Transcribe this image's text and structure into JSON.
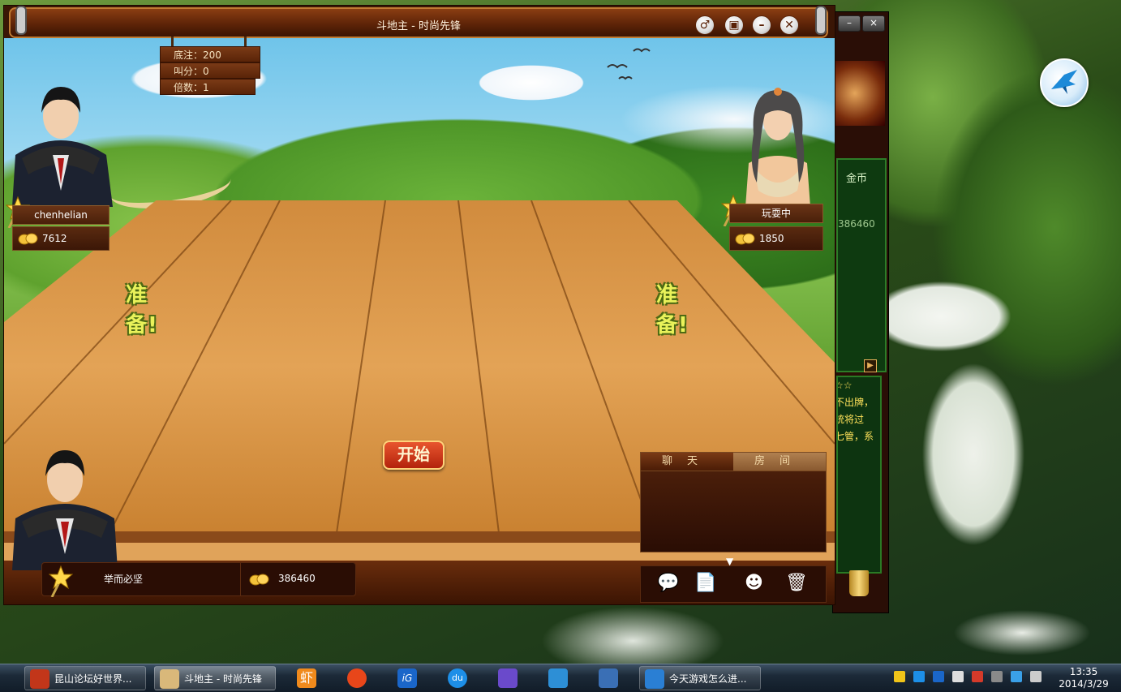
{
  "window": {
    "title": "斗地主 - 时尚先锋"
  },
  "scoreboard": {
    "base_bet": "底注：200",
    "bid": "叫分：0",
    "multiplier": "倍数：1"
  },
  "players": {
    "left": {
      "name": "chenhelian",
      "coins": "7612",
      "status": "准备!"
    },
    "right": {
      "name": "玩耍中",
      "coins": "1850",
      "status": "准备!"
    },
    "self": {
      "name": "举而必坚",
      "coins": "386460"
    }
  },
  "actions": {
    "start": "开始"
  },
  "chat": {
    "tab_chat": "聊天",
    "tab_room": "房间"
  },
  "side_panel": {
    "coin_header": "金币",
    "coin_value": "386460",
    "notice_lines": [
      "☆☆",
      "不出牌，",
      "统将过",
      "七管，系"
    ]
  },
  "taskbar": {
    "items": [
      {
        "label": "昆山论坛好世界...",
        "color": "#c2361a"
      },
      {
        "label": "斗地主 - 时尚先锋",
        "color": "#d9b87a"
      },
      {
        "label": "虾",
        "color": "#f08a1c"
      },
      {
        "label": "",
        "color": "#e8461a"
      },
      {
        "label": "iG",
        "color": "#1a66c9"
      },
      {
        "label": "du",
        "color": "#1d8fe8"
      },
      {
        "label": "",
        "color": "#6a4acb"
      },
      {
        "label": "",
        "color": "#2d8fd6"
      },
      {
        "label": "",
        "color": "#3a6fb5"
      },
      {
        "label": "今天游戏怎么进...",
        "color": "#2a7fd4"
      }
    ],
    "clock_time": "13:35",
    "clock_date": "2014/3/29"
  }
}
